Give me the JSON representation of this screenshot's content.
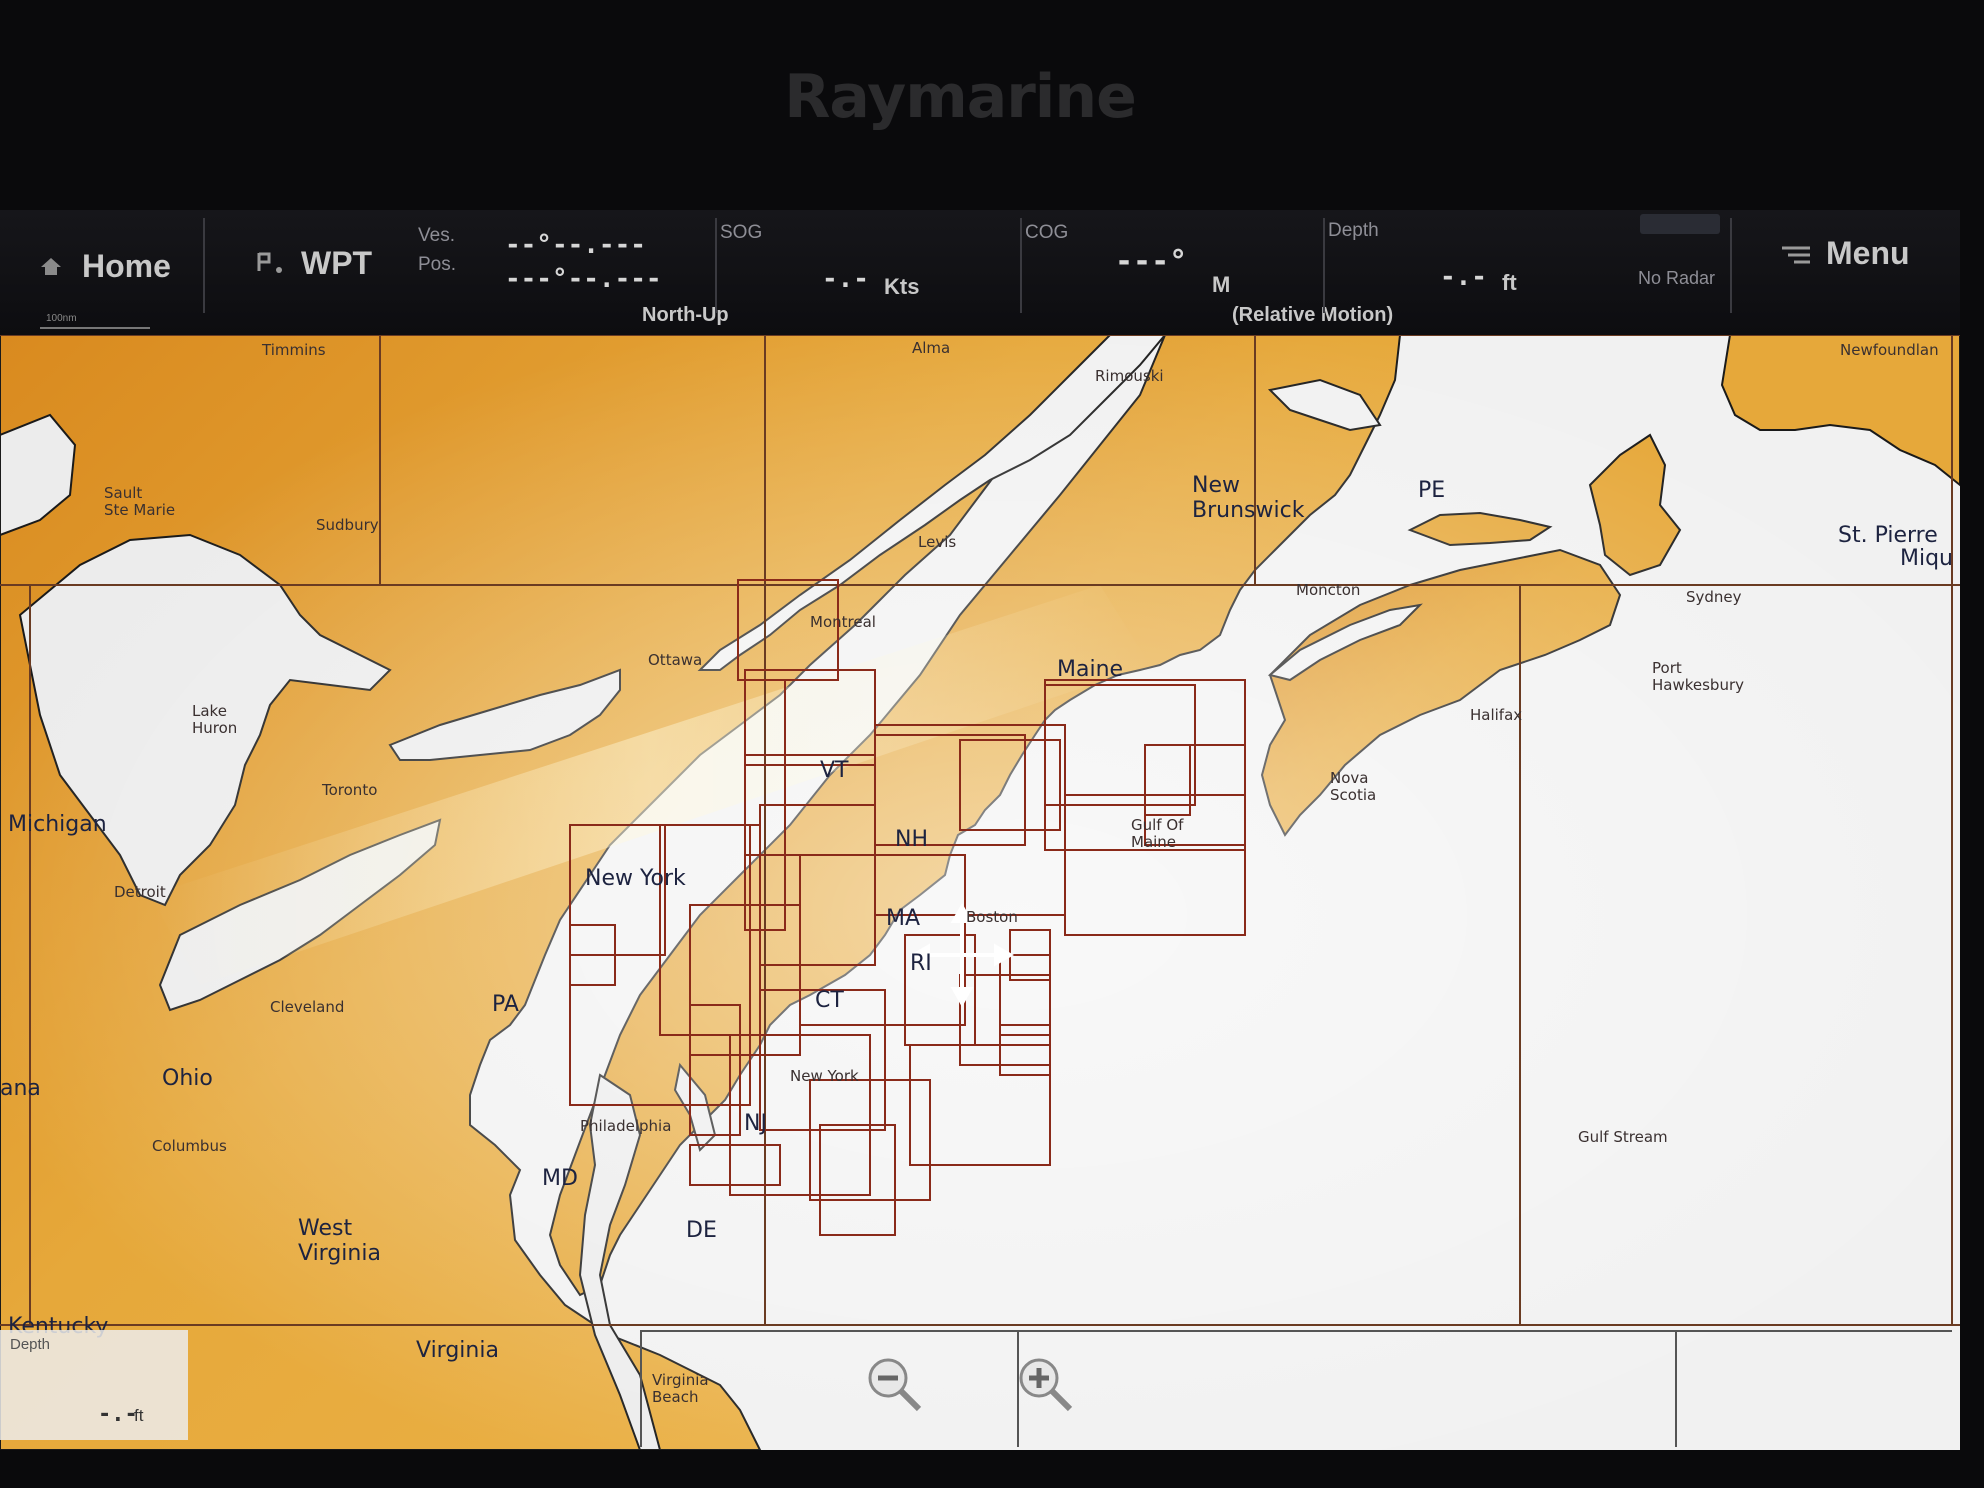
{
  "brand": "Raymarine",
  "topbar": {
    "home_label": "Home",
    "wpt_label": "WPT",
    "ves_label": "Ves.",
    "pos_label": "Pos.",
    "position_value_line1": "--°--.---",
    "position_value_line2": "---°--.---",
    "orientation": "North-Up",
    "sog_label": "SOG",
    "sog_value": "-.-",
    "sog_unit": "Kts",
    "cog_label": "COG",
    "cog_value": "---°",
    "cog_unit": "M",
    "motion_mode": "(Relative Motion)",
    "depth_label": "Depth",
    "depth_value": "-.-",
    "depth_unit": "ft",
    "radar_status": "No Radar",
    "menu_label": "Menu",
    "scale_text": "100nm"
  },
  "map": {
    "labels_big": {
      "new_brunswick_1": "New",
      "new_brunswick_2": "Brunswick",
      "pe": "PE",
      "st_pierre_1": "St. Pierre",
      "st_pierre_2": "Miqu",
      "maine": "Maine",
      "vt": "VT",
      "nh": "NH",
      "ma": "MA",
      "ri": "RI",
      "ct": "CT",
      "new_york": "New York",
      "michigan": "Michigan",
      "pa": "PA",
      "ohio": "Ohio",
      "md": "MD",
      "nj": "NJ",
      "de": "DE",
      "west_virginia_1": "West",
      "west_virginia_2": "Virginia",
      "virginia": "Virginia",
      "kentucky": "Kentucky",
      "indiana": "ana"
    },
    "labels_city": {
      "timmins": "Timmins",
      "alma": "Alma",
      "rimouski": "Rimouski",
      "newfoundland": "Newfoundlan",
      "sault_1": "Sault",
      "sault_2": "Ste Marie",
      "sudbury": "Sudbury",
      "levis": "Levis",
      "moncton": "Moncton",
      "sydney": "Sydney",
      "montreal": "Montreal",
      "ottawa": "Ottawa",
      "port_hawkesbury_1": "Port",
      "port_hawkesbury_2": "Hawkesbury",
      "lake_huron_1": "Lake",
      "lake_huron_2": "Huron",
      "toronto": "Toronto",
      "halifax": "Halifax",
      "nova_scotia_1": "Nova",
      "nova_scotia_2": "Scotia",
      "gulf_of_maine_1": "Gulf Of",
      "gulf_of_maine_2": "Maine",
      "detroit": "Detroit",
      "boston": "Boston",
      "cleveland": "Cleveland",
      "new_york_city": "New York",
      "columbus": "Columbus",
      "philadelphia": "Philadelphia",
      "gulf_stream": "Gulf Stream",
      "virginia_beach_1": "Virginia",
      "virginia_beach_2": "Beach"
    }
  },
  "bottom": {
    "depth_label": "Depth",
    "depth_value": "-.-",
    "depth_unit": "ft",
    "zoom_out_icon": "zoom-out-icon",
    "zoom_in_icon": "zoom-in-icon"
  },
  "colors": {
    "land": "#e8a93c",
    "sea": "#f2f2f2",
    "chart_border": "#8a2a1a",
    "grid_line": "#6a3b22"
  }
}
